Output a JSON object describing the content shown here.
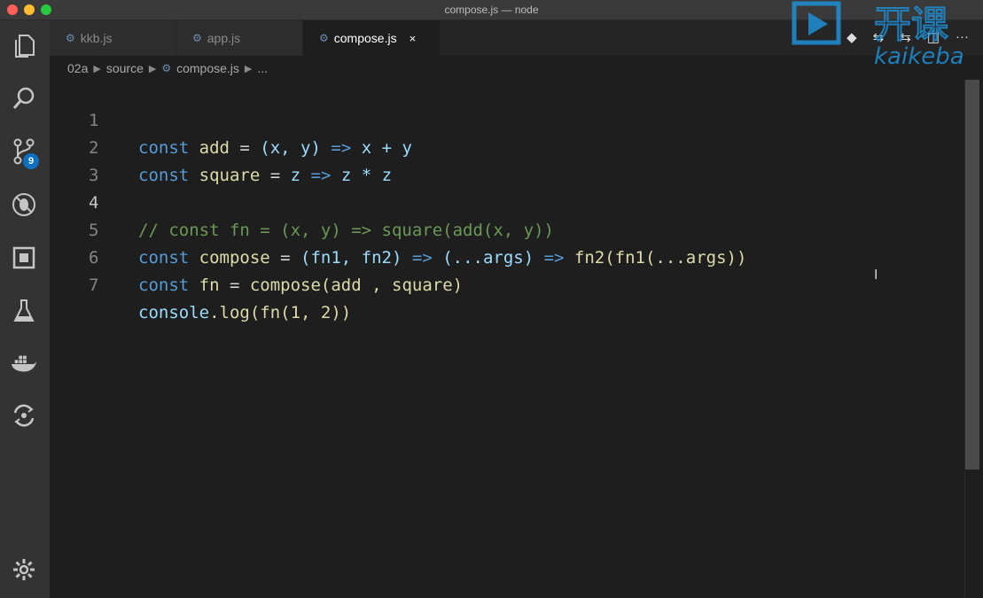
{
  "window": {
    "title": "compose.js — node"
  },
  "activity_bar": {
    "items": [
      "explorer-icon",
      "search-icon",
      "source-control-icon",
      "debug-icon",
      "extensions-icon",
      "flask-icon",
      "docker-icon",
      "live-share-icon"
    ],
    "scm_badge": "9",
    "settings": "gear-icon"
  },
  "tabs": [
    {
      "label": "kkb.js",
      "active": false
    },
    {
      "label": "app.js",
      "active": false
    },
    {
      "label": "compose.js",
      "active": true,
      "close": "×"
    }
  ],
  "editor_actions": [
    "git-icon",
    "compare-icon",
    "compare-icon",
    "split-editor-icon",
    "more-icon"
  ],
  "editor_actions_more": "···",
  "breadcrumb": {
    "items": [
      "02a",
      "source",
      "compose.js",
      "..."
    ]
  },
  "watermark": {
    "text": "开课",
    "sub": "kaikeba"
  },
  "code": {
    "current_line": 4,
    "lines": [
      {
        "n": "1"
      },
      {
        "n": "2"
      },
      {
        "n": "3"
      },
      {
        "n": "4"
      },
      {
        "n": "5"
      },
      {
        "n": "6"
      },
      {
        "n": "7"
      }
    ],
    "tokens": {
      "l1": [
        "const",
        " add",
        " = ",
        "(x, y)",
        " => ",
        "x + y"
      ],
      "l2": [
        "const",
        " square",
        " = ",
        "z",
        " => ",
        "z * z"
      ],
      "l4": "// const fn = (x, y) => square(add(x, y))",
      "l5": [
        "const",
        " compose",
        " = ",
        "(fn1, fn2)",
        " => ",
        "(...args)",
        " => ",
        "fn2(fn1(...args))"
      ],
      "l6": [
        "const",
        " fn",
        " = ",
        "compose(add , square)"
      ],
      "l7": [
        "console",
        ".log(fn(1, 2))"
      ]
    }
  },
  "colors": {
    "background": "#1e1e1e",
    "keyword": "#569cd6",
    "function": "#dcdcaa",
    "comment": "#6a9955",
    "badge": "#0e70c0"
  }
}
